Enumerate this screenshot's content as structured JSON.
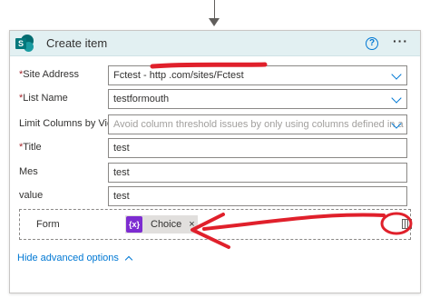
{
  "card": {
    "title": "Create item",
    "help_glyph": "?",
    "more_glyph": "···",
    "logo_letter": "S",
    "icons": {
      "logo": "sharepoint-logo",
      "help": "help-circle-icon",
      "more": "more-icon",
      "chevron": "chevron-down-icon",
      "calendar": "calendar-icon"
    }
  },
  "fields": [
    {
      "label": "Site Address",
      "required": true,
      "value": "Fctest - http                                   .com/sites/Fctest",
      "dropdown": true
    },
    {
      "label": "List Name",
      "required": true,
      "value": "testformouth",
      "dropdown": true
    },
    {
      "label": "Limit Columns by View",
      "required": false,
      "placeholder": "Avoid column threshold issues by only using columns defined in a view",
      "dropdown": true
    },
    {
      "label": "Title",
      "required": true,
      "value": "test"
    },
    {
      "label": "Mes",
      "required": false,
      "value": "test"
    },
    {
      "label": "value",
      "required": false,
      "value": "test"
    }
  ],
  "form_field": {
    "label": "Form",
    "token": {
      "icon_text": "{x}",
      "label": "Choice",
      "remove": "×"
    }
  },
  "advanced": {
    "label": "Hide advanced options"
  },
  "colors": {
    "annotation": "#e0202b",
    "accent": "#0078d4",
    "header": "#e2f0f2",
    "token_icon": "#7d2cd1"
  }
}
